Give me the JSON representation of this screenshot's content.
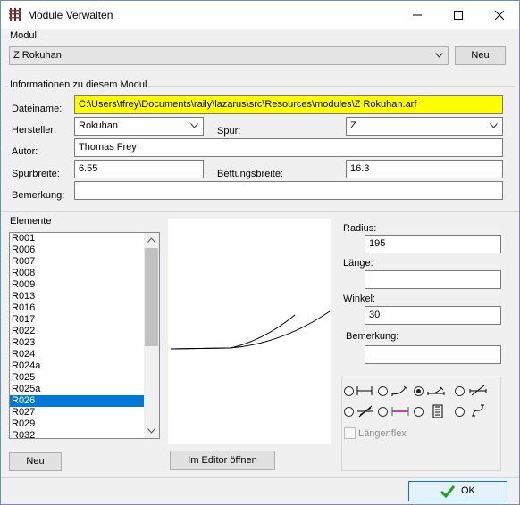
{
  "window": {
    "title": "Module Verwalten"
  },
  "modul_group": {
    "label": "Modul",
    "selected": "Z Rokuhan",
    "new_button": "Neu"
  },
  "info_group": {
    "label": "Informationen zu diesem Modul",
    "dateiname_label": "Dateiname:",
    "dateiname_value": "C:\\Users\\tfrey\\Documents\\raily\\lazarus\\src\\Resources\\modules\\Z Rokuhan.arf",
    "hersteller_label": "Hersteller:",
    "hersteller_value": "Rokuhan",
    "spur_label": "Spur:",
    "spur_value": "Z",
    "autor_label": "Autor:",
    "autor_value": "Thomas Frey",
    "spurbreite_label": "Spurbreite:",
    "spurbreite_value": "6.55",
    "bettungsbreite_label": "Bettungsbreite:",
    "bettungsbreite_value": "16.3",
    "bemerkung_label": "Bemerkung:",
    "bemerkung_value": ""
  },
  "elemente": {
    "label": "Elemente",
    "items": [
      "R001",
      "R006",
      "R007",
      "R008",
      "R009",
      "R013",
      "R016",
      "R017",
      "R022",
      "R023",
      "R024",
      "R024a",
      "R025",
      "R025a",
      "R026",
      "R027",
      "R029",
      "R032"
    ],
    "selected_index": 14,
    "new_button": "Neu",
    "editor_button": "Im Editor öffnen"
  },
  "properties": {
    "radius_label": "Radius:",
    "radius_value": "195",
    "laenge_label": "Länge:",
    "laenge_value": "",
    "winkel_label": "Winkel:",
    "winkel_value": "30",
    "bemerkung_label": "Bemerkung:",
    "bemerkung_value": ""
  },
  "type_panel": {
    "types": [
      "straight",
      "curve",
      "turnout",
      "crossing",
      "double-slip",
      "uncoupler",
      "bumper",
      "flex"
    ],
    "selected": "turnout",
    "laengenflex_label": "Längenflex"
  },
  "ok_button": "OK",
  "colors": {
    "selection": "#0078d7",
    "highlight": "#ffff00",
    "uncoupler": "#c000c0",
    "ok_check": "#22a022"
  }
}
